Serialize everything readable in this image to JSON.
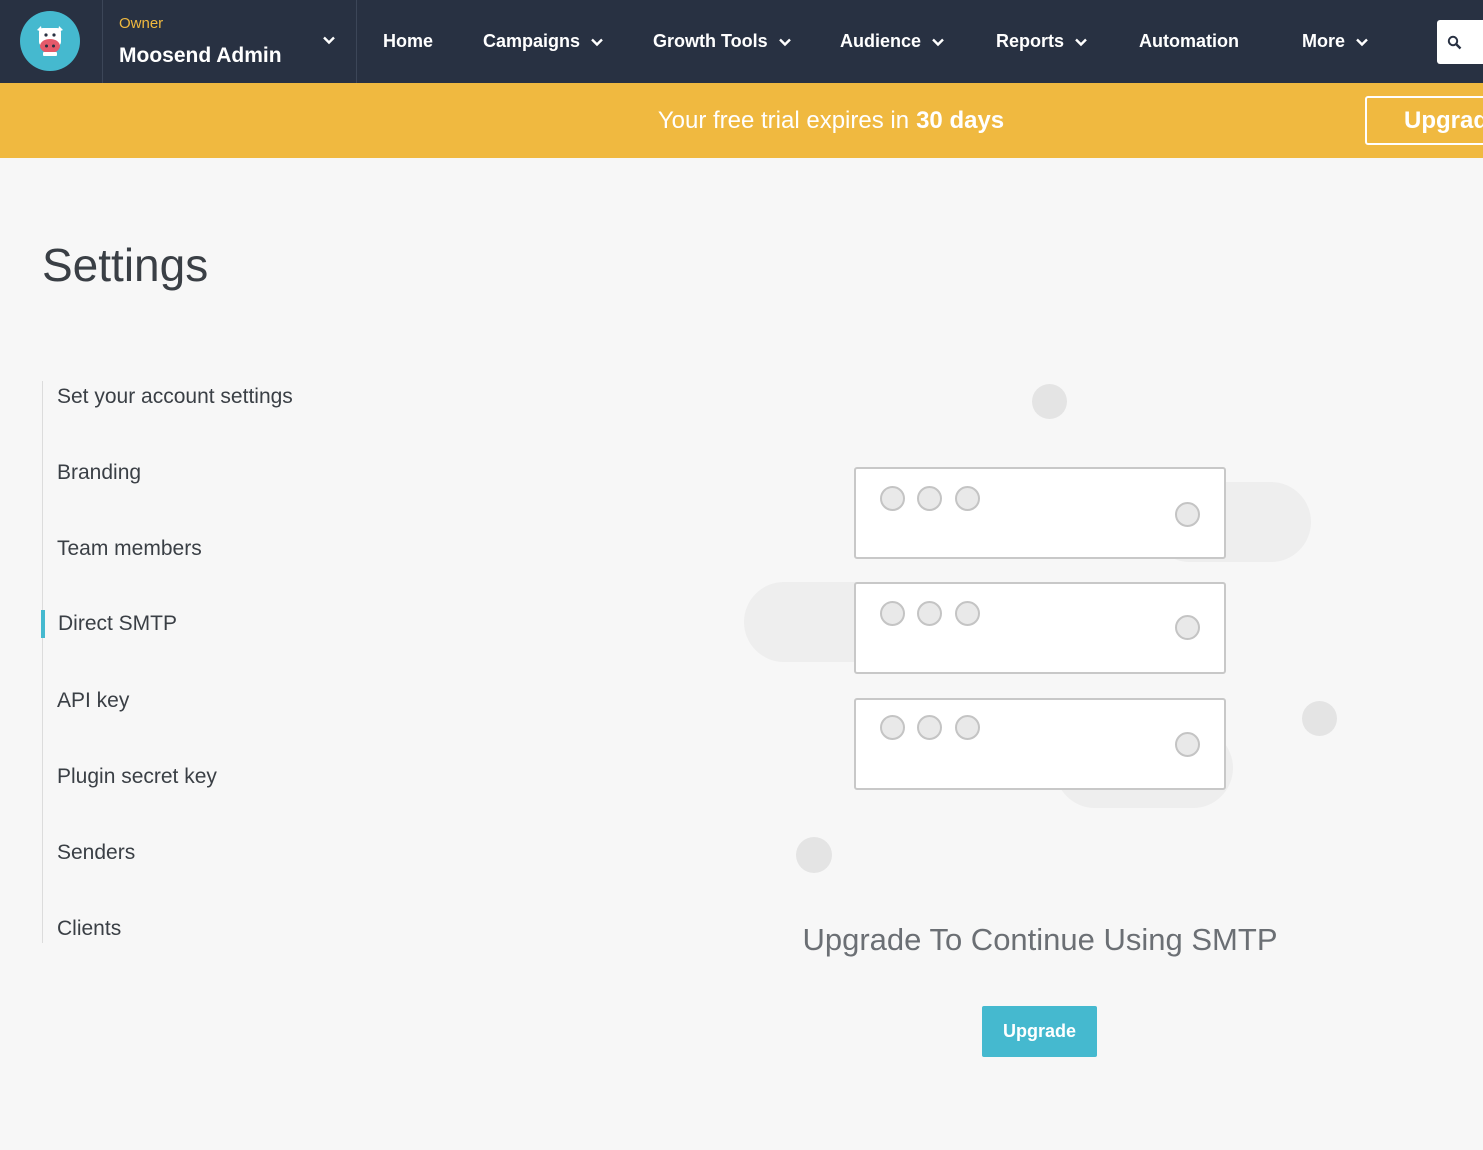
{
  "account": {
    "role": "Owner",
    "name": "Moosend Admin"
  },
  "nav": {
    "items": [
      {
        "label": "Home",
        "has_dropdown": false
      },
      {
        "label": "Campaigns",
        "has_dropdown": true
      },
      {
        "label": "Growth Tools",
        "has_dropdown": true
      },
      {
        "label": "Audience",
        "has_dropdown": true
      },
      {
        "label": "Reports",
        "has_dropdown": true
      },
      {
        "label": "Automation",
        "has_dropdown": false
      },
      {
        "label": "More",
        "has_dropdown": true
      }
    ],
    "search_icon": "search-icon"
  },
  "banner": {
    "text": "Your free trial expires in",
    "highlight": "30 days",
    "button_label": "Upgrade"
  },
  "page": {
    "title": "Settings"
  },
  "sidebar": {
    "active": "Direct SMTP",
    "items": [
      {
        "label": "Set your account settings"
      },
      {
        "label": "Branding"
      },
      {
        "label": "Team members"
      },
      {
        "label": "Direct SMTP"
      },
      {
        "label": "API key"
      },
      {
        "label": "Plugin secret key"
      },
      {
        "label": "Senders"
      },
      {
        "label": "Clients"
      }
    ]
  },
  "main": {
    "heading": "Upgrade To Continue Using SMTP",
    "button_label": "Upgrade"
  },
  "colors": {
    "nav_bg": "#283142",
    "banner_bg": "#f0b940",
    "accent": "#45b9cf",
    "role_text": "#f0b93f"
  }
}
